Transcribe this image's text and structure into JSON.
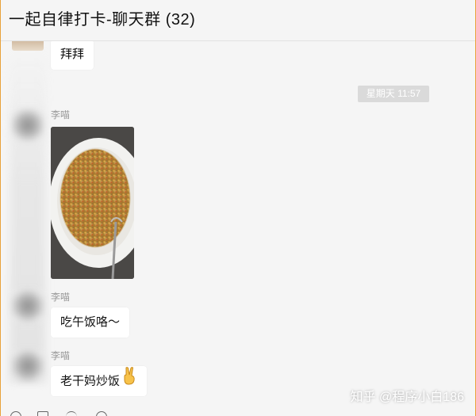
{
  "window": {
    "title": "一起自律打卡-聊天群 (32)"
  },
  "messages": [
    {
      "type": "text",
      "text": "拜拜"
    },
    {
      "type": "time",
      "text": "星期天 11:57"
    },
    {
      "type": "image",
      "sender": "李喵",
      "alt": "炒饭照片"
    },
    {
      "type": "text",
      "sender": "李喵",
      "text": "吃午饭咯～"
    },
    {
      "type": "text",
      "sender": "李喵",
      "text": "老干妈炒饭",
      "emoji": "✌"
    }
  ],
  "watermark": "知乎 @程序小白186",
  "colors": {
    "bubble": "#ffffff",
    "background": "#f5f5f5",
    "timestamp_bg": "#dadada"
  }
}
